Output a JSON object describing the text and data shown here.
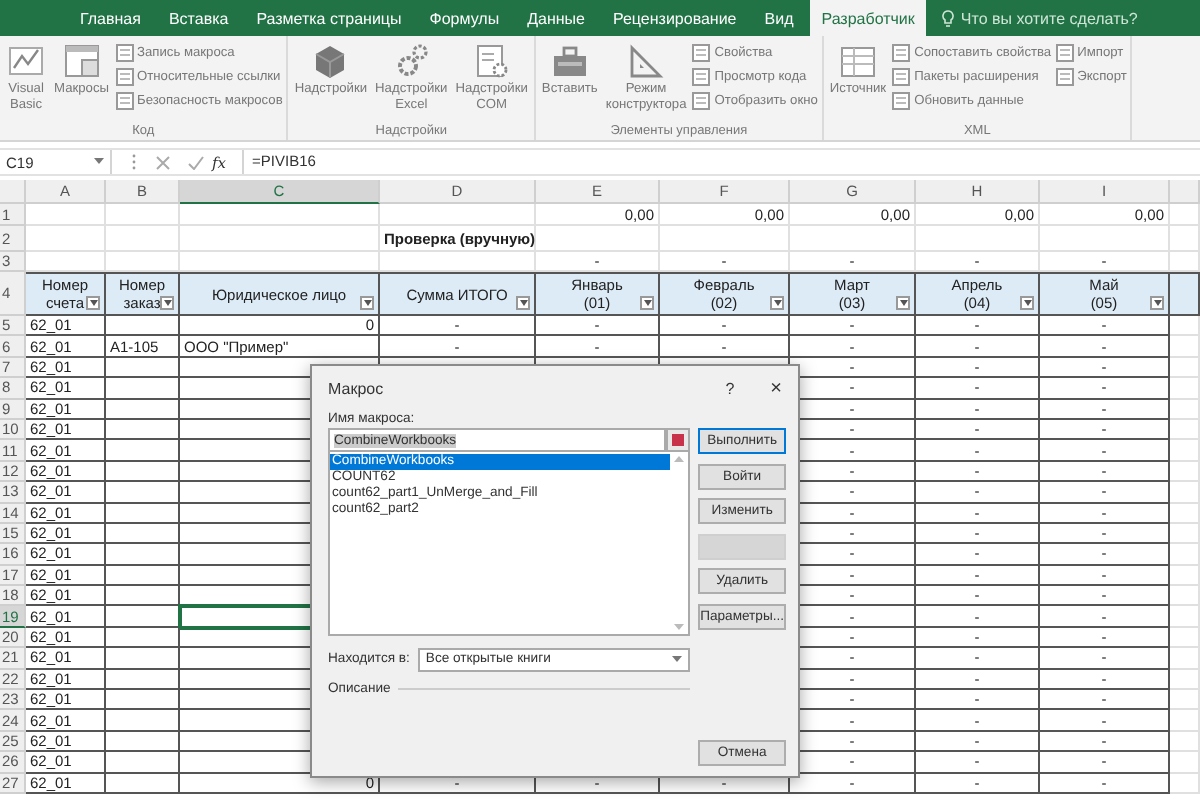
{
  "ribbon_tabs": [
    {
      "label": "Главная",
      "selected": false
    },
    {
      "label": "Вставка",
      "selected": false
    },
    {
      "label": "Разметка страницы",
      "selected": false
    },
    {
      "label": "Формулы",
      "selected": false
    },
    {
      "label": "Данные",
      "selected": false
    },
    {
      "label": "Рецензирование",
      "selected": false
    },
    {
      "label": "Вид",
      "selected": false
    },
    {
      "label": "Разработчик",
      "selected": true
    }
  ],
  "tell_me": {
    "placeholder": "Что вы хотите сделать?"
  },
  "ribbon_groups": [
    {
      "label": "Код",
      "large_buttons": [
        "Visual\nBasic",
        "Макросы"
      ],
      "small_buttons": [
        [
          "Запись макроса",
          "Относительные ссылки",
          "Безопасность макросов"
        ]
      ]
    },
    {
      "label": "Надстройки",
      "large_buttons": [
        "Надстройки",
        "Надстройки\nExcel",
        "Надстройки\nCOM"
      ]
    },
    {
      "label": "Элементы управления",
      "large_buttons": [
        "Вставить",
        "Режим\nконструктора"
      ],
      "small_buttons": [
        [
          "Свойства",
          "Просмотр кода",
          "Отобразить окно"
        ]
      ]
    },
    {
      "label": "XML",
      "large_buttons": [
        "Источник"
      ],
      "small_buttons": [
        [
          "Сопоставить свойства",
          "Пакеты расширения",
          "Обновить данные"
        ],
        [
          "Импорт",
          "Экспорт"
        ]
      ]
    }
  ],
  "formula_bar": {
    "name_box": "C19",
    "function_label": "fx",
    "formula": "=PIVIB16"
  },
  "columns": [
    {
      "letter": "A",
      "selected": false
    },
    {
      "letter": "B",
      "selected": false
    },
    {
      "letter": "C",
      "selected": true
    },
    {
      "letter": "D",
      "selected": false
    },
    {
      "letter": "E",
      "selected": false
    },
    {
      "letter": "F",
      "selected": false
    },
    {
      "letter": "G",
      "selected": false
    },
    {
      "letter": "H",
      "selected": false
    },
    {
      "letter": "I",
      "selected": false
    }
  ],
  "rows": [
    {
      "number": "1",
      "kind": "plain",
      "selected": false,
      "cells": {
        "E": "0,00",
        "F": "0,00",
        "G": "0,00",
        "H": "0,00",
        "I": "0,00"
      }
    },
    {
      "number": "2",
      "kind": "caption",
      "selected": false,
      "cells": {
        "D": "Проверка (вручную)"
      }
    },
    {
      "number": "3",
      "kind": "plain",
      "selected": false,
      "cells": {
        "E": "-",
        "F": "-",
        "G": "-",
        "H": "-",
        "I": "-"
      }
    },
    {
      "number": "4",
      "kind": "table_header",
      "selected": false,
      "cells": {
        "A": "Номер\nсчета",
        "B": "Номер\nзаказ",
        "C": "Юридическое лицо",
        "D": "Сумма ИТОГО",
        "E": "Январь\n(01)",
        "F": "Февраль\n(02)",
        "G": "Март\n(03)",
        "H": "Апрель\n(04)",
        "I": "Май\n(05)"
      }
    },
    {
      "number": "5",
      "kind": "table_row",
      "selected": false,
      "cells": {
        "A": "62_01",
        "C": "0",
        "D": "-",
        "E": "-",
        "F": "-",
        "G": "-",
        "H": "-",
        "I": "-"
      }
    },
    {
      "number": "6",
      "kind": "table_row",
      "selected": false,
      "cells": {
        "A": "62_01",
        "B": "A1-105",
        "C": "ООО \"Пример\"",
        "D": "-",
        "E": "-",
        "F": "-",
        "G": "-",
        "H": "-",
        "I": "-"
      }
    },
    {
      "number": "7",
      "kind": "table_row",
      "selected": false,
      "cells": {
        "A": "62_01",
        "G": "-",
        "H": "-",
        "I": "-"
      }
    },
    {
      "number": "8",
      "kind": "table_row",
      "selected": false,
      "cells": {
        "A": "62_01",
        "G": "-",
        "H": "-",
        "I": "-"
      }
    },
    {
      "number": "9",
      "kind": "table_row",
      "selected": false,
      "cells": {
        "A": "62_01",
        "G": "-",
        "H": "-",
        "I": "-"
      }
    },
    {
      "number": "10",
      "kind": "table_row",
      "selected": false,
      "cells": {
        "A": "62_01",
        "G": "-",
        "H": "-",
        "I": "-"
      }
    },
    {
      "number": "11",
      "kind": "table_row",
      "selected": false,
      "cells": {
        "A": "62_01",
        "G": "-",
        "H": "-",
        "I": "-"
      }
    },
    {
      "number": "12",
      "kind": "table_row",
      "selected": false,
      "cells": {
        "A": "62_01",
        "G": "-",
        "H": "-",
        "I": "-"
      }
    },
    {
      "number": "13",
      "kind": "table_row",
      "selected": false,
      "cells": {
        "A": "62_01",
        "G": "-",
        "H": "-",
        "I": "-"
      }
    },
    {
      "number": "14",
      "kind": "table_row",
      "selected": false,
      "cells": {
        "A": "62_01",
        "G": "-",
        "H": "-",
        "I": "-"
      }
    },
    {
      "number": "15",
      "kind": "table_row",
      "selected": false,
      "cells": {
        "A": "62_01",
        "G": "-",
        "H": "-",
        "I": "-"
      }
    },
    {
      "number": "16",
      "kind": "table_row",
      "selected": false,
      "cells": {
        "A": "62_01",
        "G": "-",
        "H": "-",
        "I": "-"
      }
    },
    {
      "number": "17",
      "kind": "table_row",
      "selected": false,
      "cells": {
        "A": "62_01",
        "G": "-",
        "H": "-",
        "I": "-"
      }
    },
    {
      "number": "18",
      "kind": "table_row",
      "selected": false,
      "cells": {
        "A": "62_01",
        "G": "-",
        "H": "-",
        "I": "-"
      }
    },
    {
      "number": "19",
      "kind": "table_row",
      "selected": true,
      "cells": {
        "A": "62_01",
        "G": "-",
        "H": "-",
        "I": "-"
      }
    },
    {
      "number": "20",
      "kind": "table_row",
      "selected": false,
      "cells": {
        "A": "62_01",
        "G": "-",
        "H": "-",
        "I": "-"
      }
    },
    {
      "number": "21",
      "kind": "table_row",
      "selected": false,
      "cells": {
        "A": "62_01",
        "G": "-",
        "H": "-",
        "I": "-"
      }
    },
    {
      "number": "22",
      "kind": "table_row",
      "selected": false,
      "cells": {
        "A": "62_01",
        "G": "-",
        "H": "-",
        "I": "-"
      }
    },
    {
      "number": "23",
      "kind": "table_row",
      "selected": false,
      "cells": {
        "A": "62_01",
        "G": "-",
        "H": "-",
        "I": "-"
      }
    },
    {
      "number": "24",
      "kind": "table_row",
      "selected": false,
      "cells": {
        "A": "62_01",
        "G": "-",
        "H": "-",
        "I": "-"
      }
    },
    {
      "number": "25",
      "kind": "table_row",
      "selected": false,
      "cells": {
        "A": "62_01",
        "G": "-",
        "H": "-",
        "I": "-"
      }
    },
    {
      "number": "26",
      "kind": "table_row",
      "selected": false,
      "cells": {
        "A": "62_01",
        "G": "-",
        "H": "-",
        "I": "-"
      }
    },
    {
      "number": "27",
      "kind": "table_row",
      "selected": false,
      "cells": {
        "A": "62_01",
        "C": "0",
        "D": "-",
        "E": "-",
        "F": "-",
        "G": "-",
        "H": "-",
        "I": "-"
      }
    }
  ],
  "dialog": {
    "title": "Макрос",
    "help": "?",
    "close": "×",
    "name_label": "Имя макроса:",
    "name_value": "CombineWorkbooks",
    "macros": [
      {
        "label": "CombineWorkbooks",
        "selected": true
      },
      {
        "label": "COUNT62",
        "selected": false
      },
      {
        "label": "count62_part1_UnMerge_and_Fill",
        "selected": false
      },
      {
        "label": "count62_part2",
        "selected": false
      }
    ],
    "buttons": [
      {
        "label": "Выполнить",
        "disabled": false,
        "default": true
      },
      {
        "label": "Войти",
        "disabled": false,
        "default": false
      },
      {
        "label": "Изменить",
        "disabled": false,
        "default": false
      },
      {
        "disabled": true,
        "default": false
      },
      {
        "label": "Удалить",
        "disabled": false,
        "default": false
      },
      {
        "label": "Параметры...",
        "disabled": false,
        "default": false
      }
    ],
    "location_label": "Находится в:",
    "location_value": "Все открытые книги",
    "description_label": "Описание",
    "cancel": "Отмена"
  }
}
